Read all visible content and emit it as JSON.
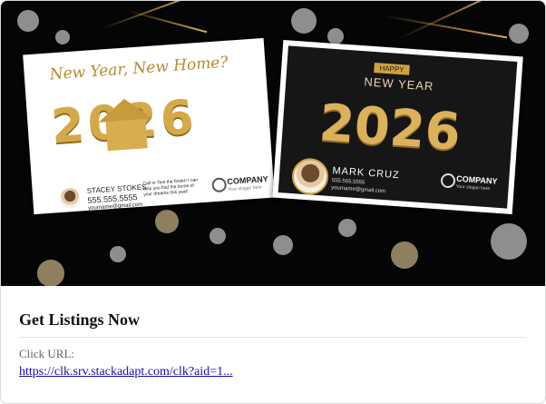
{
  "creative": {
    "left_card": {
      "tagline": "New Year, New Home?",
      "year": "2026",
      "agent_name": "STACEY STOKES",
      "agent_phone": "555.555.5555",
      "agent_email": "yourname@gmail.com",
      "cta": "Call or Text the finder! I can help you find the home of your dreams this year!",
      "company": "COMPANY",
      "company_tagline": "Your slogan here"
    },
    "right_card": {
      "badge": "HAPPY",
      "headline": "NEW YEAR",
      "year": "2026",
      "agent_name": "MARK CRUZ",
      "agent_phone": "555.555.5555",
      "agent_email": "yourname@gmail.com",
      "company": "COMPANY",
      "company_tagline": "Your slogan here"
    }
  },
  "content": {
    "title": "Get Listings Now",
    "click_label": "Click URL:",
    "url": "https://clk.srv.stackadapt.com/clk?aid=1..."
  },
  "colors": {
    "gold": "#d6a948",
    "link": "#1a0dab"
  }
}
